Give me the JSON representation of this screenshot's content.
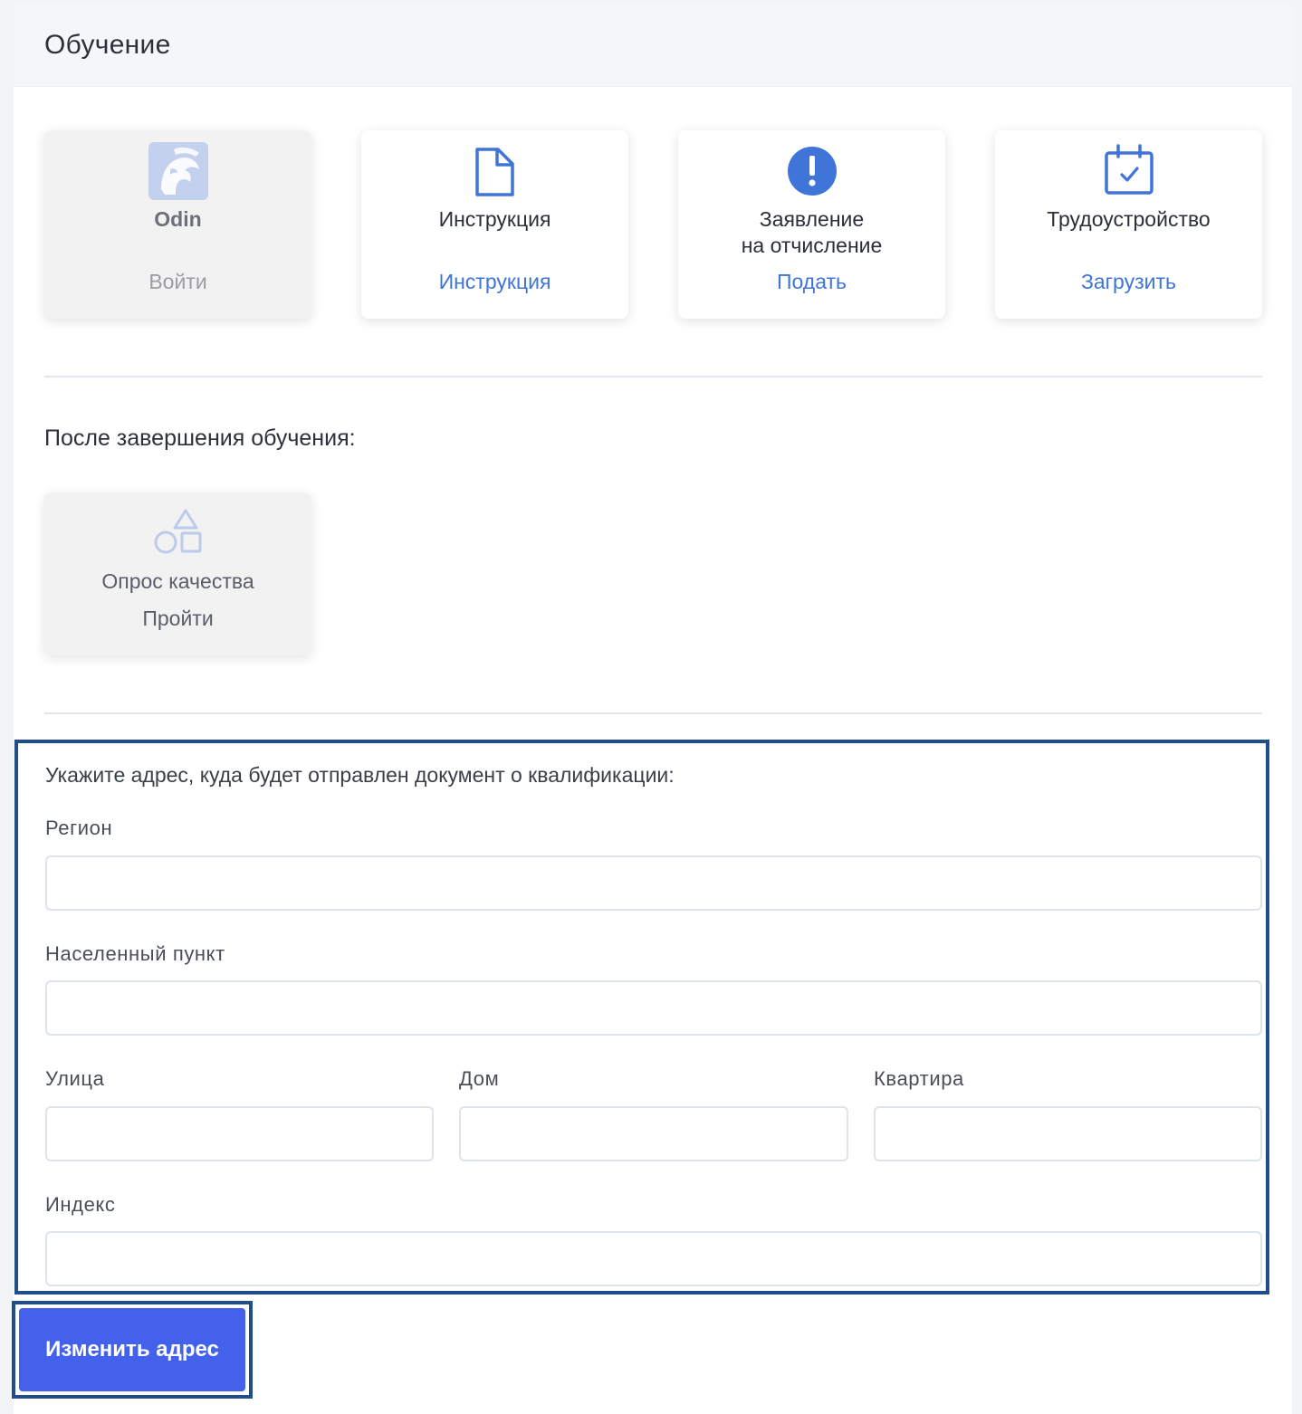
{
  "header": {
    "title": "Обучение"
  },
  "cards": [
    {
      "title": "Odin",
      "action": "Войти",
      "icon": "odin-logo-icon",
      "state": "disabled"
    },
    {
      "title": "Инструкция",
      "action": "Инструкция",
      "icon": "document-icon"
    },
    {
      "title_line1": "Заявление",
      "title_line2": "на отчисление",
      "action": "Подать",
      "icon": "alert-circle-icon"
    },
    {
      "title": "Трудоустройство",
      "action": "Загрузить",
      "icon": "calendar-check-icon"
    }
  ],
  "after_section": {
    "title": "После завершения обучения:",
    "survey": {
      "title": "Опрос качества",
      "action": "Пройти",
      "icon": "shapes-icon"
    }
  },
  "address_form": {
    "heading": "Укажите адрес, куда будет отправлен документ о квалификации:",
    "region_label": "Регион",
    "region_value": "",
    "city_label": "Населенный пункт",
    "city_value": "",
    "street_label": "Улица",
    "street_value": "",
    "house_label": "Дом",
    "house_value": "",
    "apartment_label": "Квартира",
    "apartment_value": "",
    "index_label": "Индекс",
    "index_value": "",
    "submit_label": "Изменить адрес"
  },
  "colors": {
    "accent": "#4461ec",
    "link": "#3f74d9",
    "highlight_border": "#1f4e8a"
  }
}
